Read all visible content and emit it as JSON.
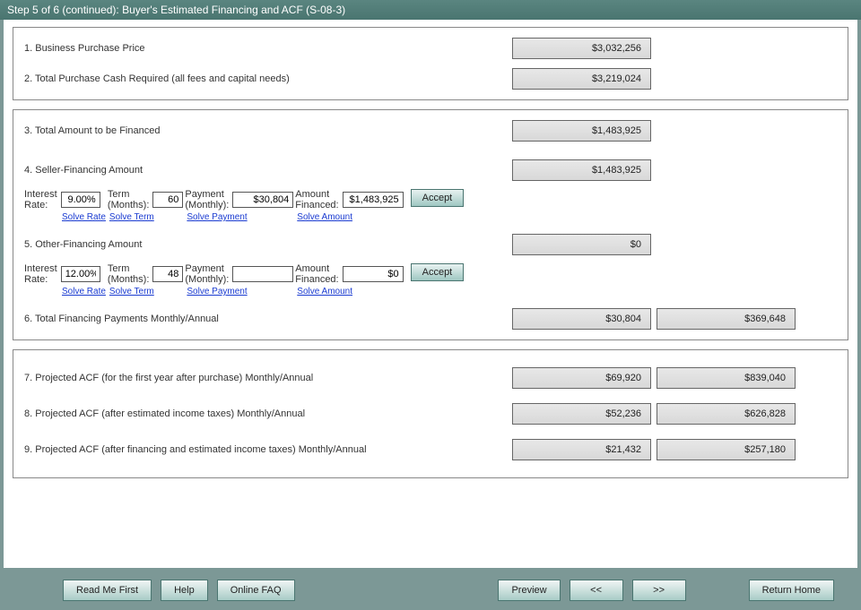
{
  "title": "Step 5 of 6 (continued): Buyer's Estimated Financing and ACF (S-08-3)",
  "section1": {
    "line1_label": "1. Business Purchase Price",
    "line1_value": "$3,032,256",
    "line2_label": "2. Total Purchase Cash Required (all fees and capital needs)",
    "line2_value": "$3,219,024"
  },
  "section2": {
    "line3_label": "3. Total Amount to be Financed",
    "line3_value": "$1,483,925",
    "line4_label": "4. Seller-Financing Amount",
    "line4_value": "$1,483,925",
    "seller_fin": {
      "rate_label": "Interest Rate:",
      "rate_value": "9.00%",
      "solve_rate": "Solve Rate",
      "term_label": "Term (Months):",
      "term_value": "60",
      "solve_term": "Solve Term",
      "pay_label": "Payment (Monthly):",
      "pay_value": "$30,804",
      "solve_pay": "Solve Payment",
      "amt_label": "Amount Financed:",
      "amt_value": "$1,483,925",
      "solve_amt": "Solve Amount",
      "accept": "Accept"
    },
    "line5_label": "5. Other-Financing Amount",
    "line5_value": "$0",
    "other_fin": {
      "rate_label": "Interest Rate:",
      "rate_value": "12.00%",
      "solve_rate": "Solve Rate",
      "term_label": "Term (Months):",
      "term_value": "48",
      "solve_term": "Solve Term",
      "pay_label": "Payment (Monthly):",
      "pay_value": "",
      "solve_pay": "Solve Payment",
      "amt_label": "Amount Financed:",
      "amt_value": "$0",
      "solve_amt": "Solve Amount",
      "accept": "Accept"
    },
    "line6_label": "6. Total Financing Payments Monthly/Annual",
    "line6_monthly": "$30,804",
    "line6_annual": "$369,648"
  },
  "section3": {
    "line7_label": "7. Projected ACF (for the first year after purchase) Monthly/Annual",
    "line7_monthly": "$69,920",
    "line7_annual": "$839,040",
    "line8_label": "8. Projected ACF (after estimated income taxes) Monthly/Annual",
    "line8_monthly": "$52,236",
    "line8_annual": "$626,828",
    "line9_label": "9. Projected ACF (after financing and estimated income taxes) Monthly/Annual",
    "line9_monthly": "$21,432",
    "line9_annual": "$257,180"
  },
  "buttons": {
    "read_me": "Read Me First",
    "help": "Help",
    "faq": "Online FAQ",
    "preview": "Preview",
    "prev": "<<",
    "next": ">>",
    "home": "Return Home"
  }
}
